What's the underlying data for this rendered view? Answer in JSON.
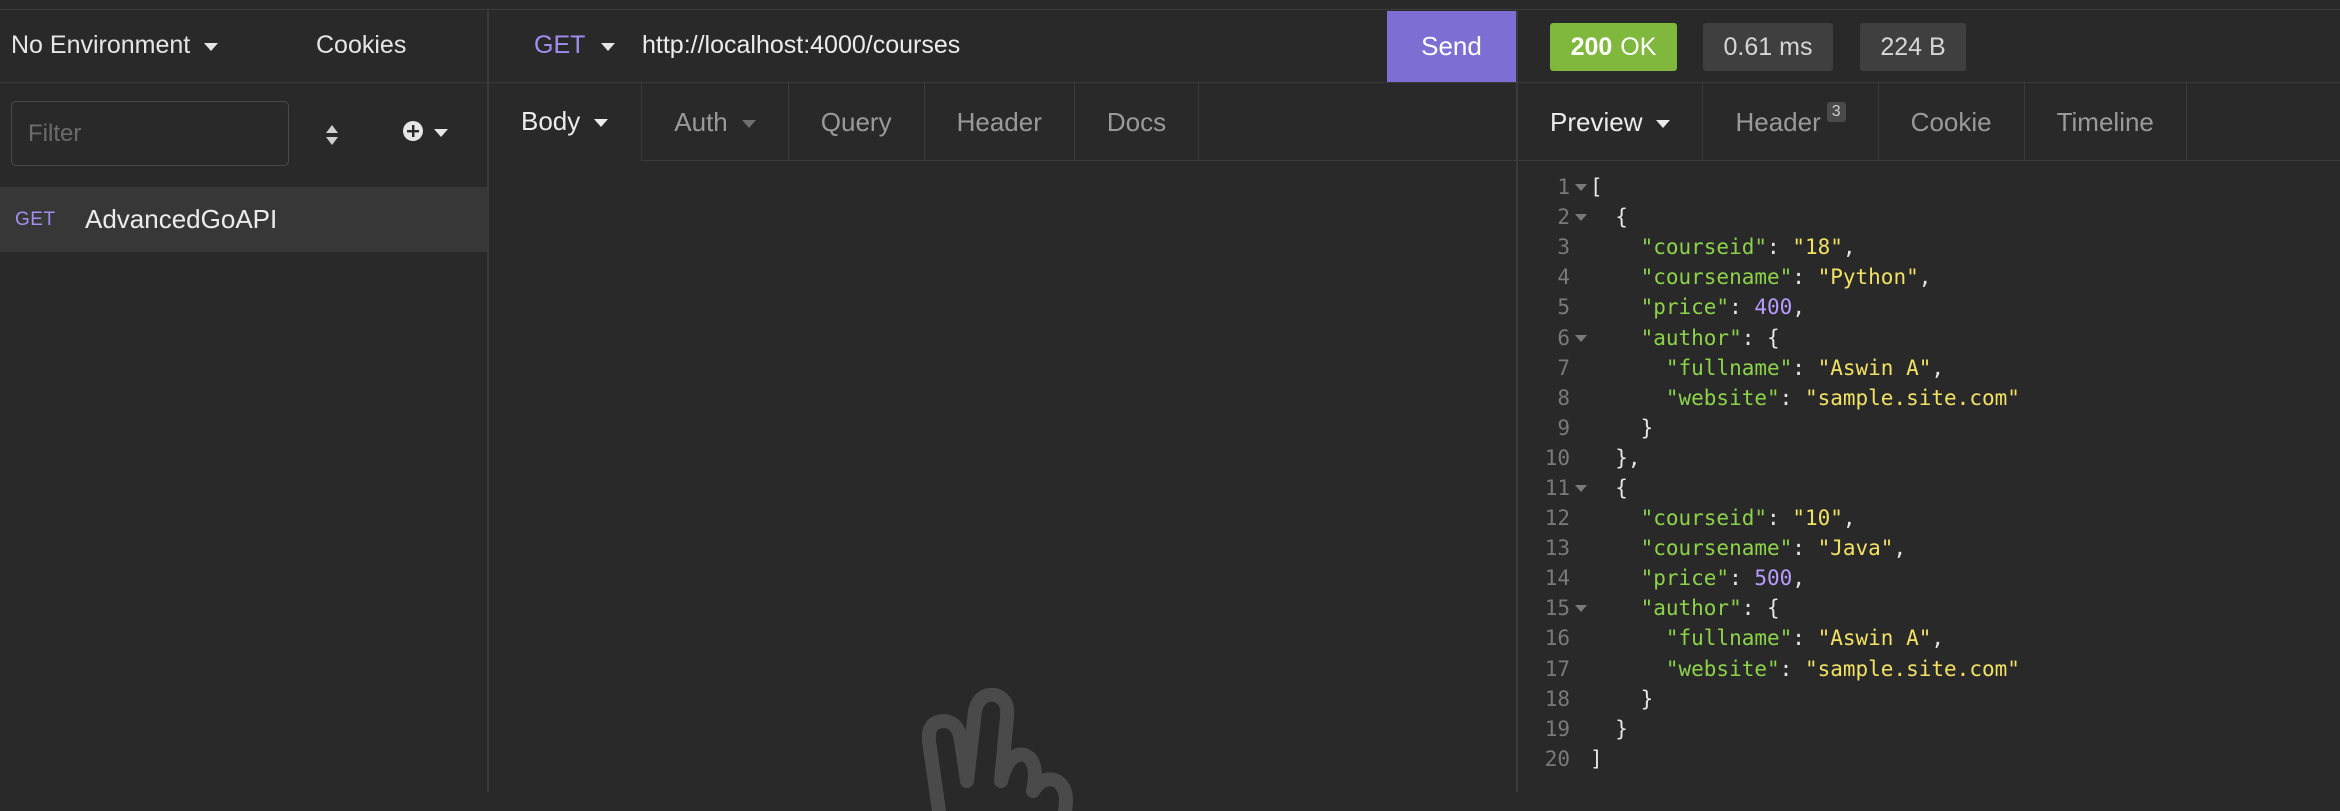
{
  "sidebar": {
    "environment_label": "No Environment",
    "cookies_label": "Cookies",
    "filter_placeholder": "Filter",
    "requests": [
      {
        "method": "GET",
        "name": "AdvancedGoAPI"
      }
    ]
  },
  "request": {
    "method": "GET",
    "url": "http://localhost:4000/courses",
    "send_label": "Send",
    "tabs": [
      {
        "label": "Body"
      },
      {
        "label": "Auth"
      },
      {
        "label": "Query"
      },
      {
        "label": "Header"
      },
      {
        "label": "Docs"
      }
    ]
  },
  "response": {
    "status_code": "200",
    "status_text": "OK",
    "time": "0.61 ms",
    "size": "224 B",
    "tabs": [
      {
        "label": "Preview"
      },
      {
        "label": "Header",
        "count": "3"
      },
      {
        "label": "Cookie"
      },
      {
        "label": "Timeline"
      }
    ],
    "lines": [
      {
        "n": "1",
        "fold": true,
        "html": "<span class='txt'>[</span>"
      },
      {
        "n": "2",
        "fold": true,
        "html": "<span class='txt'>  {</span>"
      },
      {
        "n": "3",
        "fold": false,
        "html": "<span class='k'>    \"courseid\"</span><span class='txt'>: </span><span class='s'>\"18\"</span><span class='txt'>,</span>"
      },
      {
        "n": "4",
        "fold": false,
        "html": "<span class='k'>    \"coursename\"</span><span class='txt'>: </span><span class='s'>\"Python\"</span><span class='txt'>,</span>"
      },
      {
        "n": "5",
        "fold": false,
        "html": "<span class='k'>    \"price\"</span><span class='txt'>: </span><span class='n'>400</span><span class='txt'>,</span>"
      },
      {
        "n": "6",
        "fold": true,
        "html": "<span class='k'>    \"author\"</span><span class='txt'>: {</span>"
      },
      {
        "n": "7",
        "fold": false,
        "html": "<span class='k'>      \"fullname\"</span><span class='txt'>: </span><span class='s'>\"Aswin A\"</span><span class='txt'>,</span>"
      },
      {
        "n": "8",
        "fold": false,
        "html": "<span class='k'>      \"website\"</span><span class='txt'>: </span><span class='s'>\"sample.site.com\"</span>"
      },
      {
        "n": "9",
        "fold": false,
        "html": "<span class='txt'>    }</span>"
      },
      {
        "n": "10",
        "fold": false,
        "html": "<span class='txt'>  },</span>"
      },
      {
        "n": "11",
        "fold": true,
        "html": "<span class='txt'>  {</span>"
      },
      {
        "n": "12",
        "fold": false,
        "html": "<span class='k'>    \"courseid\"</span><span class='txt'>: </span><span class='s'>\"10\"</span><span class='txt'>,</span>"
      },
      {
        "n": "13",
        "fold": false,
        "html": "<span class='k'>    \"coursename\"</span><span class='txt'>: </span><span class='s'>\"Java\"</span><span class='txt'>,</span>"
      },
      {
        "n": "14",
        "fold": false,
        "html": "<span class='k'>    \"price\"</span><span class='txt'>: </span><span class='n'>500</span><span class='txt'>,</span>"
      },
      {
        "n": "15",
        "fold": true,
        "html": "<span class='k'>    \"author\"</span><span class='txt'>: {</span>"
      },
      {
        "n": "16",
        "fold": false,
        "html": "<span class='k'>      \"fullname\"</span><span class='txt'>: </span><span class='s'>\"Aswin A\"</span><span class='txt'>,</span>"
      },
      {
        "n": "17",
        "fold": false,
        "html": "<span class='k'>      \"website\"</span><span class='txt'>: </span><span class='s'>\"sample.site.com\"</span>"
      },
      {
        "n": "18",
        "fold": false,
        "html": "<span class='txt'>    }</span>"
      },
      {
        "n": "19",
        "fold": false,
        "html": "<span class='txt'>  }</span>"
      },
      {
        "n": "20",
        "fold": false,
        "html": "<span class='txt'>]</span>"
      }
    ]
  },
  "colors": {
    "accent": "#7d6ed4",
    "method_get": "#a38ef0",
    "status_ok": "#7fb83c",
    "json_key": "#8dd34a",
    "json_string": "#f2e264",
    "json_number": "#b89cff"
  }
}
